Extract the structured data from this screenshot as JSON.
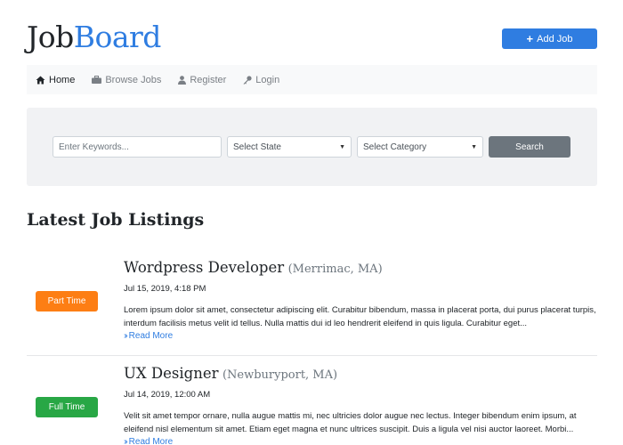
{
  "logo": {
    "part1": "Job",
    "part2": "Board"
  },
  "header": {
    "add_job_label": "Add Job",
    "add_job_icon": "plus-icon"
  },
  "nav": {
    "items": [
      {
        "label": "Home",
        "icon": "home-icon",
        "active": true
      },
      {
        "label": "Browse Jobs",
        "icon": "briefcase-icon",
        "active": false
      },
      {
        "label": "Register",
        "icon": "user-icon",
        "active": false
      },
      {
        "label": "Login",
        "icon": "key-icon",
        "active": false
      }
    ]
  },
  "search": {
    "keywords_placeholder": "Enter Keywords...",
    "state_selected": "Select State",
    "category_selected": "Select Category",
    "button_label": "Search"
  },
  "listings": {
    "title": "Latest Job Listings",
    "jobs": [
      {
        "badge": "Part Time",
        "badge_color": "#fd7e14",
        "title": "Wordpress Developer",
        "location": "(Merrimac, MA)",
        "date": "Jul 15, 2019, 4:18 PM",
        "description": "Lorem ipsum dolor sit amet, consectetur adipiscing elit. Curabitur bibendum, massa in placerat porta, dui purus placerat turpis, interdum facilisis metus velit id tellus. Nulla mattis dui id leo hendrerit eleifend in quis ligula. Curabitur eget...",
        "read_more": "Read More"
      },
      {
        "badge": "Full Time",
        "badge_color": "#28a745",
        "title": "UX Designer",
        "location": "(Newburyport, MA)",
        "date": "Jul 14, 2019, 12:00 AM",
        "description": "Velit sit amet tempor ornare, nulla augue mattis mi, nec ultricies dolor augue nec lectus. Integer bibendum enim ipsum, at eleifend nisl elementum sit amet. Etiam eget magna et nunc ultrices suscipit. Duis a ligula vel nisi auctor laoreet. Morbi...",
        "read_more": "Read More"
      }
    ]
  },
  "colors": {
    "accent": "#2f7de1",
    "muted": "#6c757d"
  }
}
